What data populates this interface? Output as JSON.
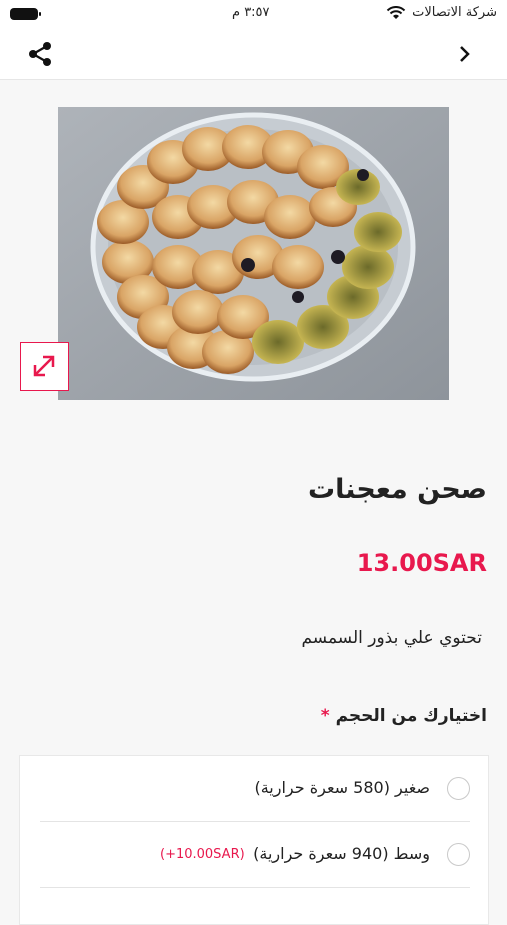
{
  "status_bar": {
    "carrier": "شركة الاتصالات",
    "time": "٣:٥٧ م"
  },
  "product": {
    "title": "صحن معجنات",
    "price": "13.00SAR",
    "description": "تحتوي علي بذور السمسم"
  },
  "size_section": {
    "title": "اختيارك من الحجم",
    "required_mark": "*",
    "options": [
      {
        "label": "صغير (580 سعرة حرارية)",
        "extra": ""
      },
      {
        "label": "وسط (940 سعرة حرارية)",
        "extra": "(+10.00SAR)"
      }
    ]
  },
  "colors": {
    "accent": "#e8184d"
  },
  "icons": {
    "share": "share-icon",
    "back": "chevron-right-icon",
    "expand": "expand-icon"
  }
}
